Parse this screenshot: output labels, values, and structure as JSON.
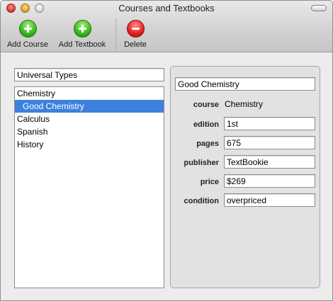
{
  "window": {
    "title": "Courses and Textbooks"
  },
  "toolbar": {
    "add_course": {
      "label": "Add Course",
      "icon": "plus-icon",
      "color": "#35b71e"
    },
    "add_textbook": {
      "label": "Add Textbook",
      "icon": "plus-icon",
      "color": "#35b71e"
    },
    "delete": {
      "label": "Delete",
      "icon": "minus-icon",
      "color": "#e0221b"
    }
  },
  "left": {
    "top_field_value": "Universal Types",
    "items": [
      {
        "label": "Chemistry"
      },
      {
        "label": "Good Chemistry"
      },
      {
        "label": "Calculus"
      },
      {
        "label": "Spanish"
      },
      {
        "label": "History"
      }
    ],
    "selection_color": "#3d80df"
  },
  "detail": {
    "title_value": "Good Chemistry",
    "labels": {
      "course": "course",
      "edition": "edition",
      "pages": "pages",
      "publisher": "publisher",
      "price": "price",
      "condition": "condition"
    },
    "values": {
      "course": "Chemistry",
      "edition": "1st",
      "pages": "675",
      "publisher": "TextBookie",
      "price": "$269",
      "condition": "overpriced"
    }
  }
}
